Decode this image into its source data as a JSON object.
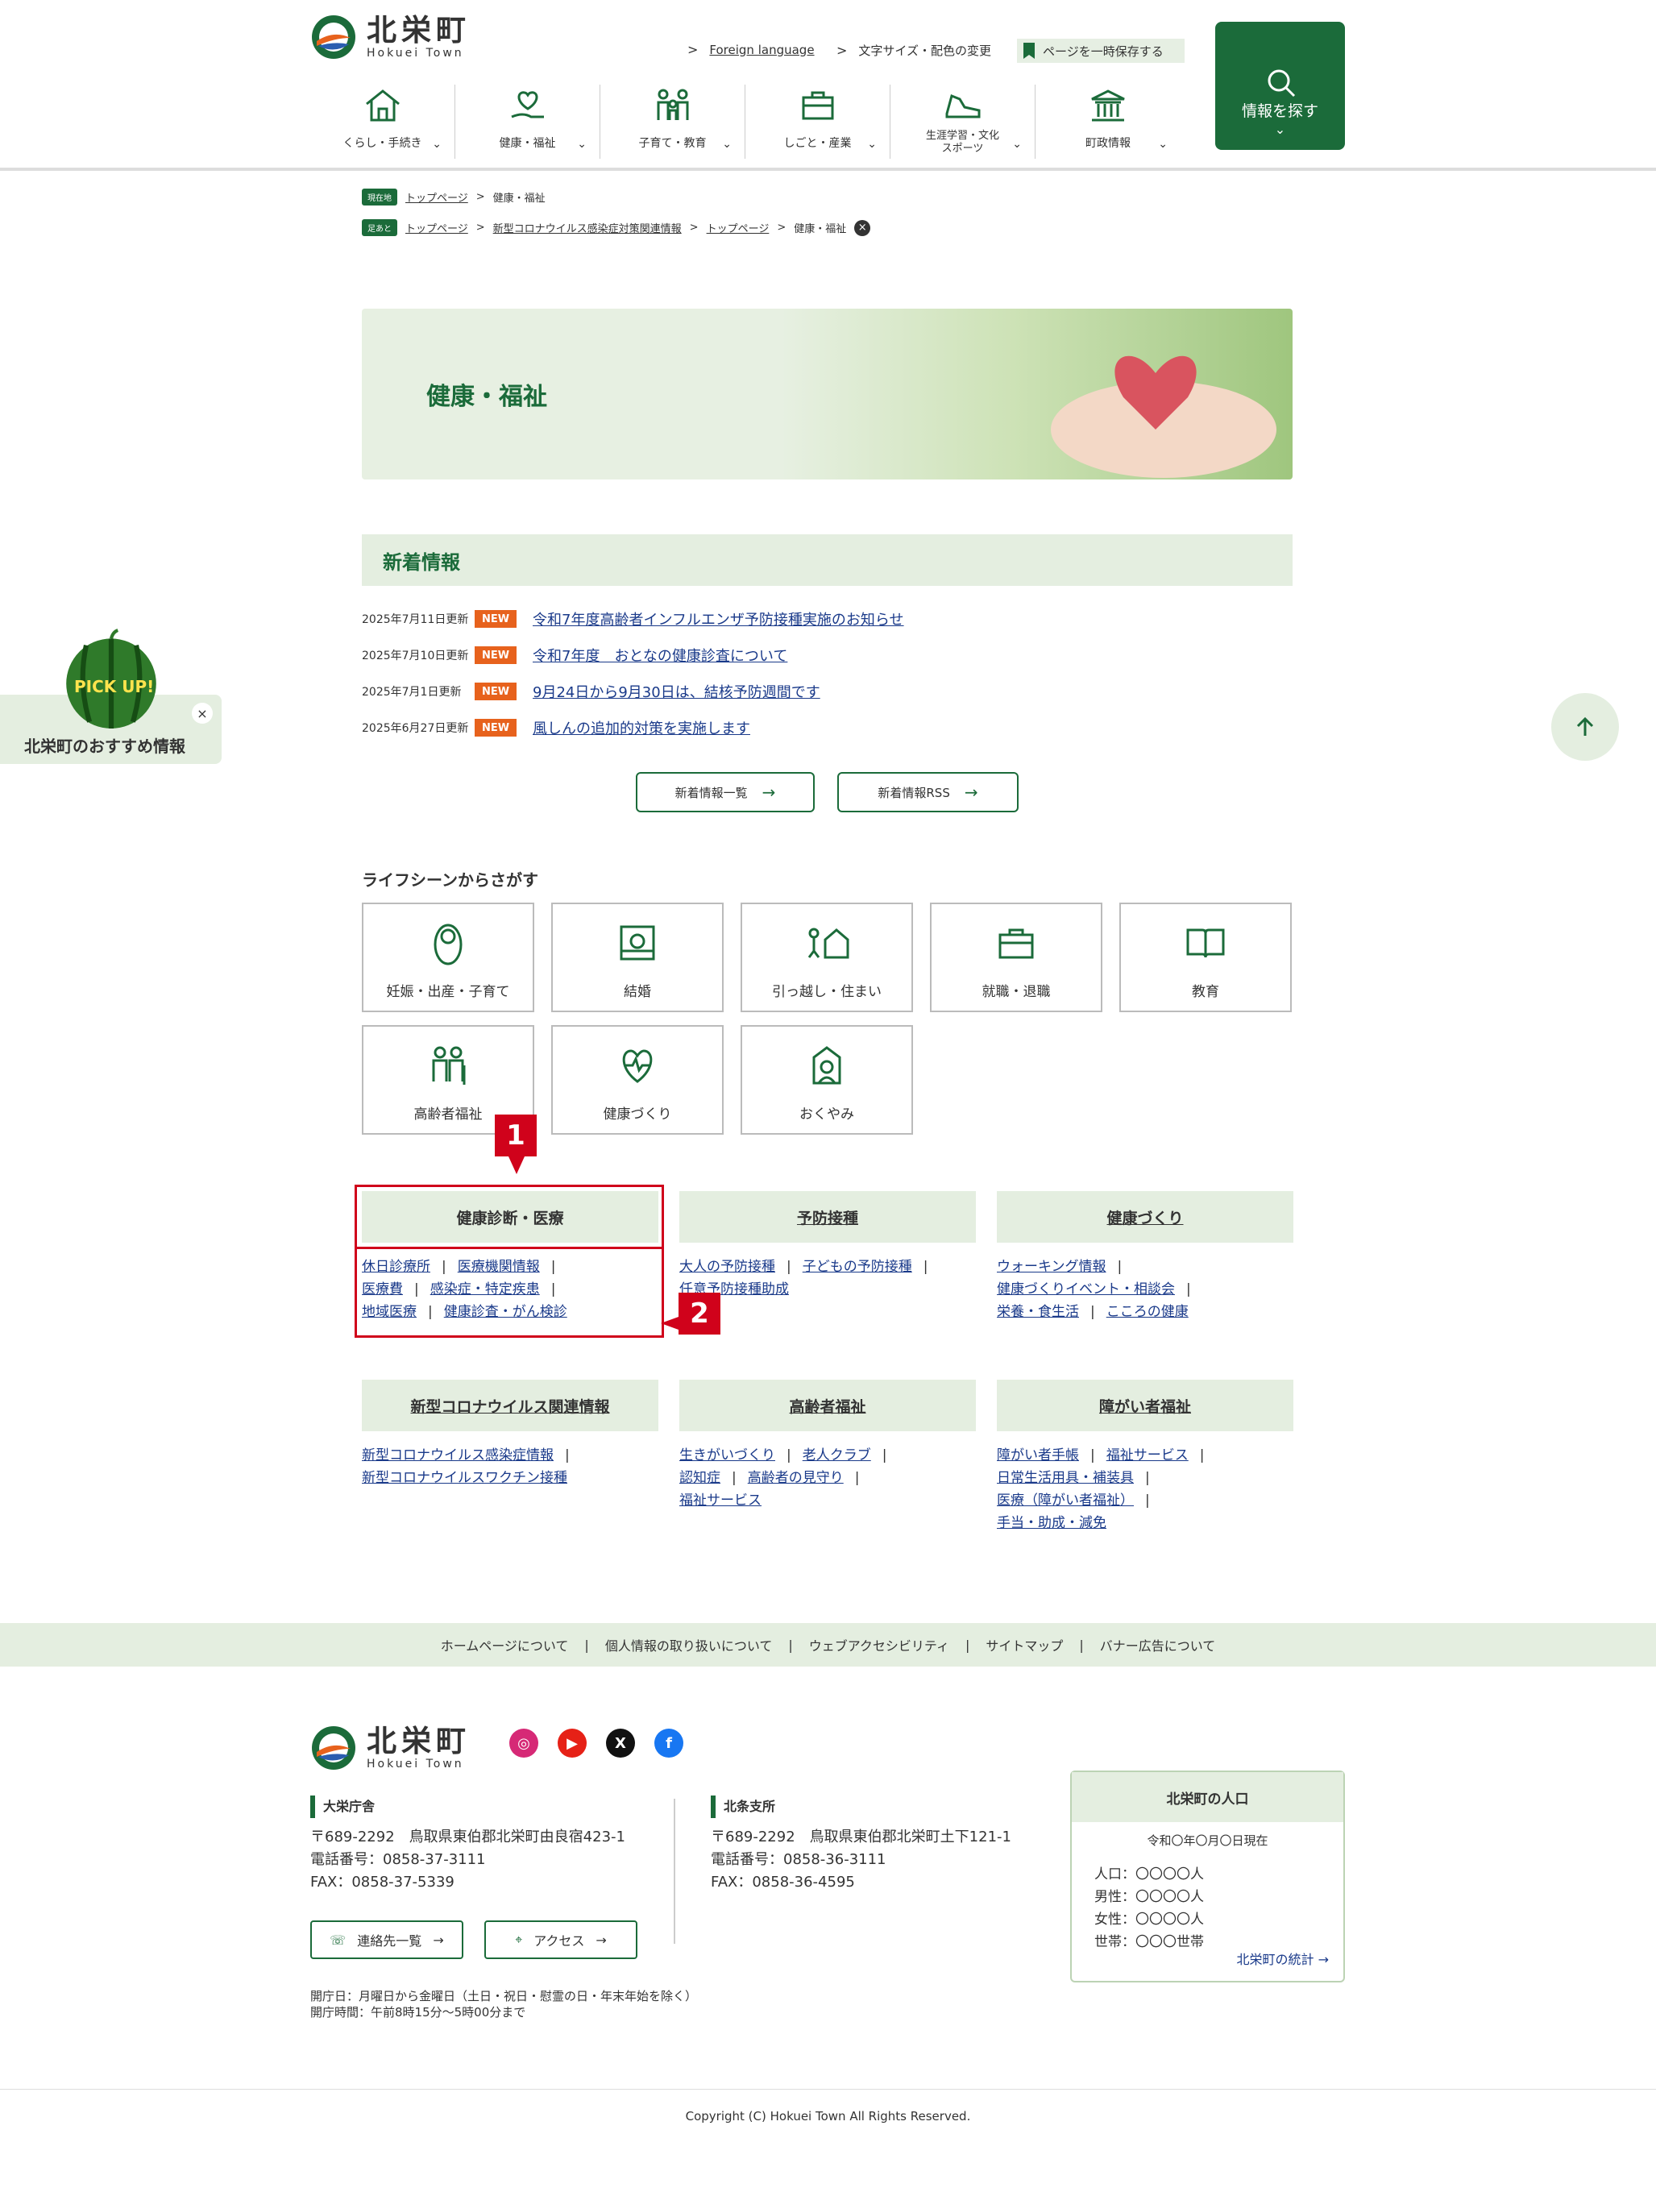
{
  "header": {
    "logo_jp": "北栄町",
    "logo_en": "Hokuei Town",
    "foreign": "Foreign language",
    "textsize": "文字サイズ・配色の変更",
    "save": "ページを一時保存する",
    "search": "情報を探す",
    "nav": [
      {
        "label": "くらし・手続き"
      },
      {
        "label": "健康・福祉"
      },
      {
        "label": "子育て・教育"
      },
      {
        "label": "しごと・産業"
      },
      {
        "label": "生涯学習・文化\nスポーツ"
      },
      {
        "label": "町政情報"
      }
    ]
  },
  "breadcrumb": {
    "current_tag": "現在地",
    "footprint_tag": "足あと",
    "current": [
      "トップページ",
      "健康・福祉"
    ],
    "footprint": [
      "トップページ",
      "新型コロナウイルス感染症対策関連情報",
      "トップページ",
      "健康・福祉"
    ],
    "sep": ">"
  },
  "hero": {
    "title": "健康・福祉"
  },
  "news": {
    "title": "新着情報",
    "new_label": "NEW",
    "items": [
      {
        "date": "2025年7月11日更新",
        "title": "令和7年度高齢者インフルエンザ予防接種実施のお知らせ"
      },
      {
        "date": "2025年7月10日更新",
        "title": "令和7年度　おとなの健康診査について"
      },
      {
        "date": "2025年7月1日更新",
        "title": "9月24日から9月30日は、結核予防週間です"
      },
      {
        "date": "2025年6月27日更新",
        "title": "風しんの追加的対策を実施します"
      }
    ],
    "list_btn": "新着情報一覧",
    "rss_btn": "新着情報RSS"
  },
  "life": {
    "title": "ライフシーンからさがす",
    "items": [
      "妊娠・出産・子育て",
      "結婚",
      "引っ越し・住まい",
      "就職・退職",
      "教育",
      "高齢者福祉",
      "健康づくり",
      "おくやみ"
    ]
  },
  "categories": [
    {
      "title": "健康診断・医療",
      "links": [
        [
          "休日診療所",
          "医療機関情報"
        ],
        [
          "医療費",
          "感染症・特定疾患"
        ],
        [
          "地域医療",
          "健康診査・がん検診"
        ]
      ]
    },
    {
      "title": "予防接種",
      "links": [
        [
          "大人の予防接種",
          "子どもの予防接種"
        ],
        [
          "任意予防接種助成"
        ]
      ]
    },
    {
      "title": "健康づくり",
      "links": [
        [
          "ウォーキング情報"
        ],
        [
          "健康づくりイベント・相談会"
        ],
        [
          "栄養・食生活",
          "こころの健康"
        ]
      ]
    },
    {
      "title": "新型コロナウイルス関連情報",
      "links": [
        [
          "新型コロナウイルス感染症情報"
        ],
        [
          "新型コロナウイルスワクチン接種"
        ]
      ]
    },
    {
      "title": "高齢者福祉",
      "links": [
        [
          "生きがいづくり",
          "老人クラブ"
        ],
        [
          "認知症",
          "高齢者の見守り"
        ],
        [
          "福祉サービス"
        ]
      ]
    },
    {
      "title": "障がい者福祉",
      "links": [
        [
          "障がい者手帳",
          "福祉サービス"
        ],
        [
          "日常生活用具・補装具"
        ],
        [
          "医療（障がい者福祉）"
        ],
        [
          "手当・助成・減免"
        ]
      ]
    }
  ],
  "markers": [
    "1",
    "2"
  ],
  "pickup": {
    "badge": "PICK UP!",
    "label": "北栄町のおすすめ情報"
  },
  "footer": {
    "nav": [
      "ホームページについて",
      "個人情報の取り扱いについて",
      "ウェブアクセシビリティ",
      "サイトマップ",
      "バナー広告について"
    ],
    "offices": [
      {
        "name": "大栄庁舎",
        "addr": "〒689-2292　鳥取県東伯郡北栄町由良宿423-1",
        "tel": "電話番号：0858-37-3111",
        "fax": "FAX：0858-37-5339"
      },
      {
        "name": "北条支所",
        "addr": "〒689-2292　鳥取県東伯郡北栄町土下121-1",
        "tel": "電話番号：0858-36-3111",
        "fax": "FAX：0858-36-4595"
      }
    ],
    "contact_btn": "連絡先一覧",
    "access_btn": "アクセス",
    "hours1": "開庁日：月曜日から金曜日（土日・祝日・慰霊の日・年末年始を除く）",
    "hours2": "開庁時間：午前8時15分～5時00分まで",
    "population": {
      "title": "北栄町の人口",
      "date": "令和〇年〇月〇日現在",
      "rows": [
        "人口：〇〇〇〇人",
        "男性：〇〇〇〇人",
        "女性：〇〇〇〇人",
        "世帯：〇〇〇世帯"
      ],
      "link": "北栄町の統計"
    },
    "copyright": "Copyright (C) Hokuei Town All Rights Reserved."
  },
  "colors": {
    "brand": "#1b6b3a",
    "accent": "#e7621d",
    "highlight": "#d0021b",
    "panel": "#e4eee0"
  }
}
